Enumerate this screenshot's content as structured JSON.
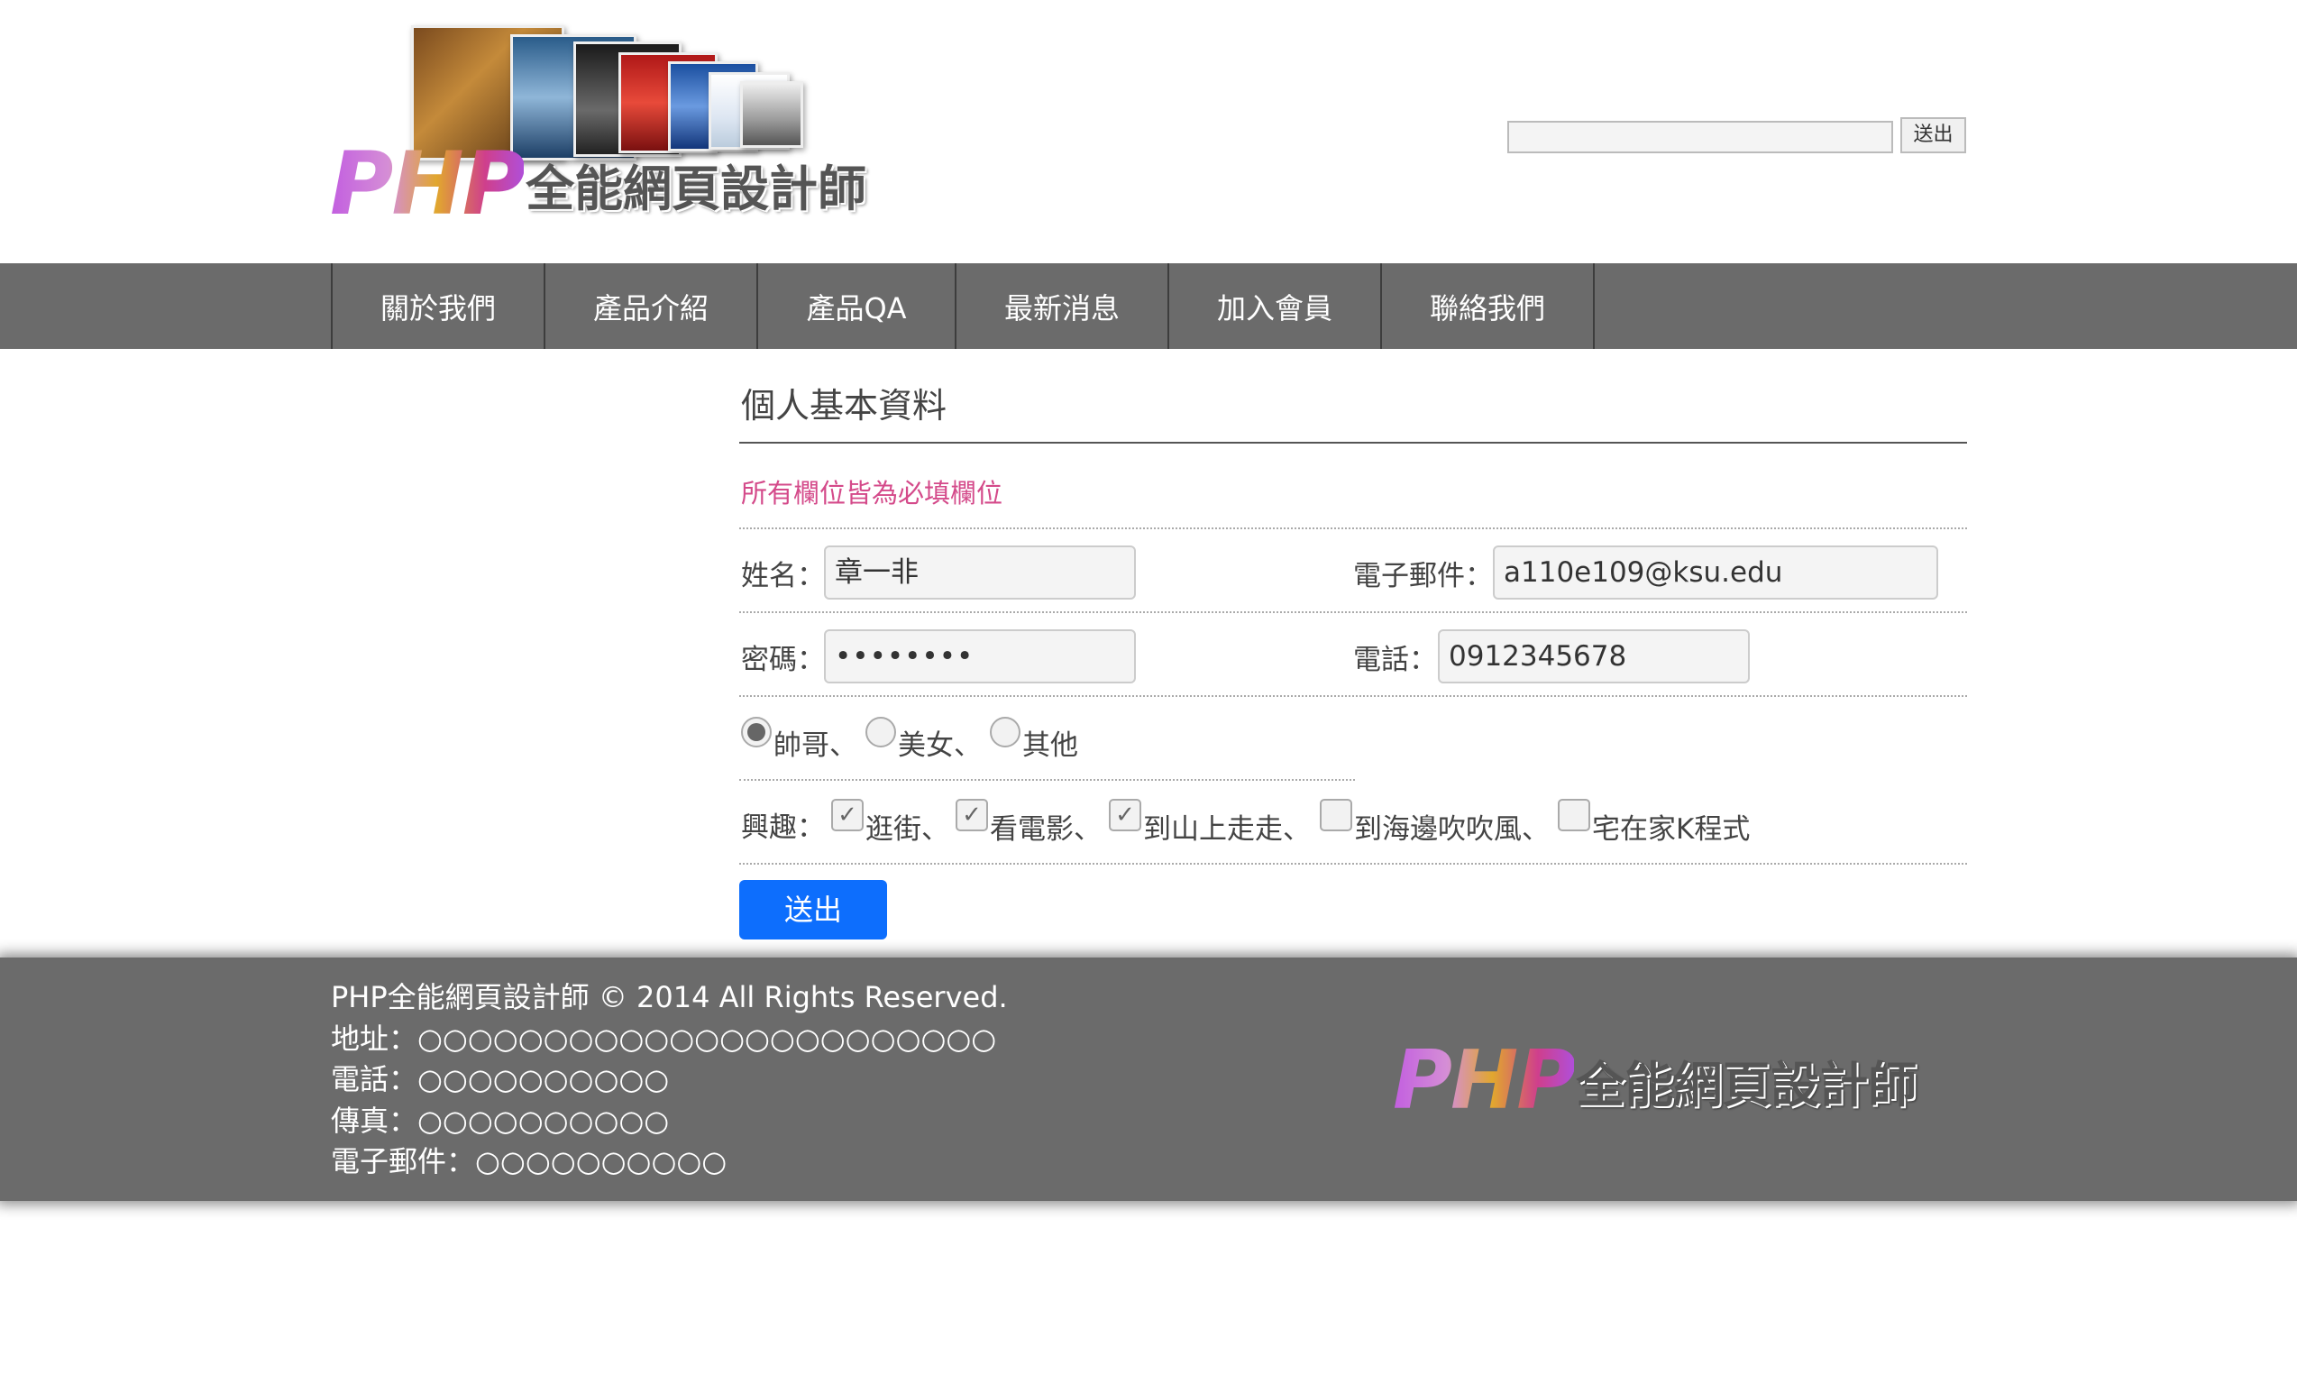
{
  "header": {
    "logo": {
      "brand": "PHP",
      "name": "全能網頁設計師"
    },
    "search": {
      "value": "",
      "button_label": "送出"
    }
  },
  "nav": {
    "items": [
      {
        "label": "關於我們"
      },
      {
        "label": "產品介紹"
      },
      {
        "label": "產品QA"
      },
      {
        "label": "最新消息"
      },
      {
        "label": "加入會員"
      },
      {
        "label": "聯絡我們"
      }
    ]
  },
  "form": {
    "title": "個人基本資料",
    "notice": "所有欄位皆為必填欄位",
    "name_label": "姓名：",
    "name_value": "章一非",
    "email_label": "電子郵件：",
    "email_value": "a110e109@ksu.edu",
    "password_label": "密碼：",
    "password_value": "••••••••",
    "phone_label": "電話：",
    "phone_value": "0912345678",
    "gender": [
      {
        "label": "帥哥、",
        "checked": true
      },
      {
        "label": "美女、",
        "checked": false
      },
      {
        "label": "其他",
        "checked": false
      }
    ],
    "hobby_label": "興趣：",
    "hobbies": [
      {
        "label": "逛街、",
        "checked": true
      },
      {
        "label": "看電影、",
        "checked": true
      },
      {
        "label": "到山上走走、",
        "checked": true
      },
      {
        "label": "到海邊吹吹風、",
        "checked": false
      },
      {
        "label": "宅在家K程式",
        "checked": false
      }
    ],
    "submit_label": "送出"
  },
  "footer": {
    "copyright": "PHP全能網頁設計師 © 2014 All Rights Reserved.",
    "address": "地址：○○○○○○○○○○○○○○○○○○○○○○○",
    "phone": "電話：○○○○○○○○○○",
    "fax": "傳真：○○○○○○○○○○",
    "email": "電子郵件：○○○○○○○○○○",
    "logo": {
      "brand": "PHP",
      "name": "全能網頁設計師"
    }
  },
  "colors": {
    "nav_bg": "#6b6b6b",
    "notice": "#d44a8a",
    "submit_bg": "#0d6efd"
  }
}
